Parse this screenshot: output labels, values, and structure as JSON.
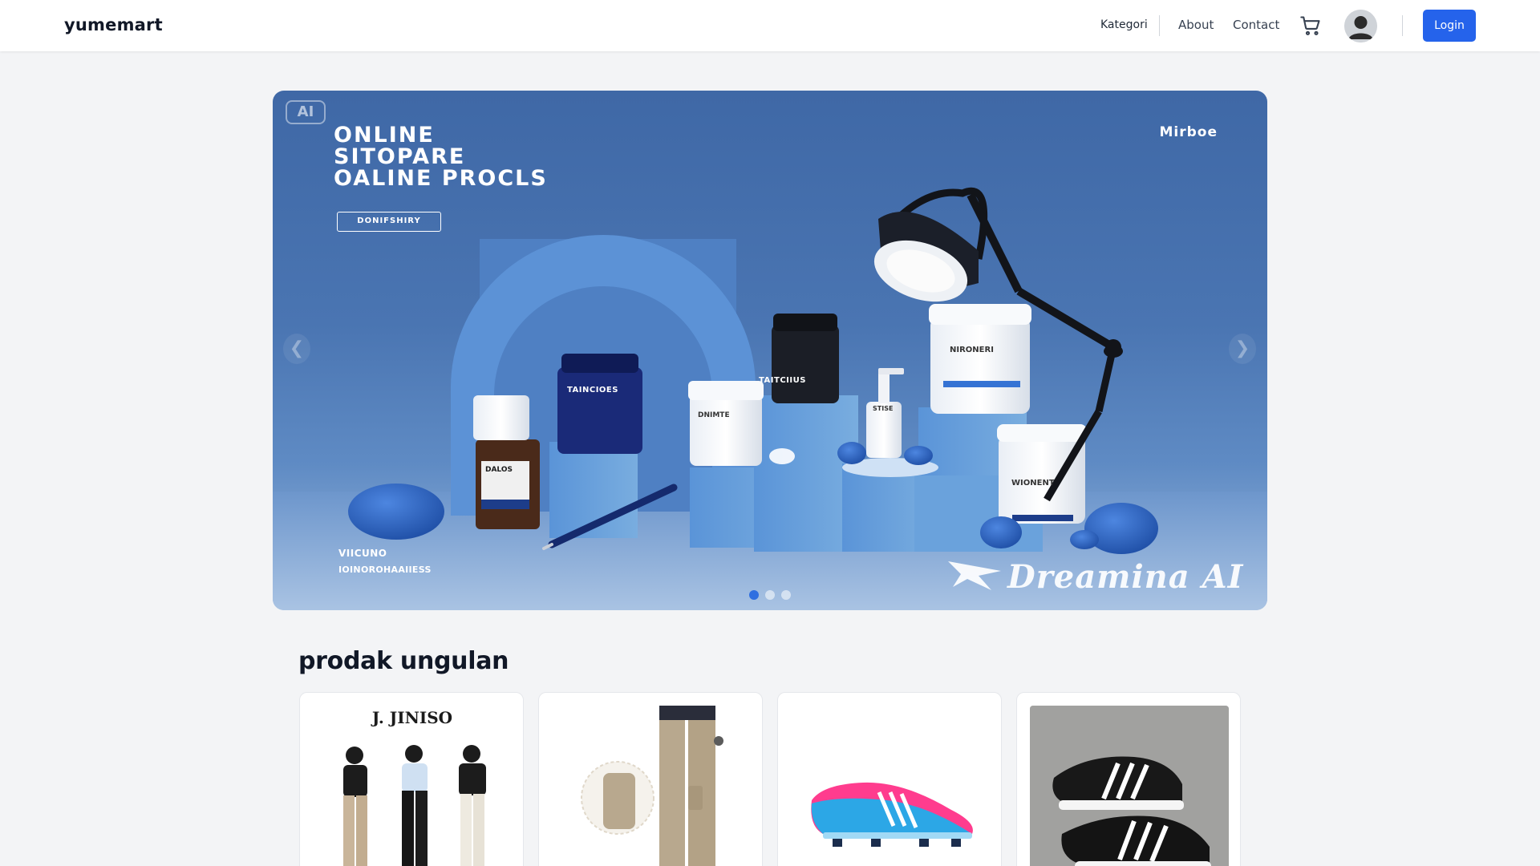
{
  "navbar": {
    "brand": "yumemart",
    "links": {
      "kategori": "Kategori",
      "about": "About",
      "contact": "Contact"
    },
    "login_label": "Login"
  },
  "hero": {
    "badge": "AI",
    "headline": [
      "ONLINE",
      "SITOPARE",
      "OALINE PROCLS"
    ],
    "tag": "DONIFSHIRY",
    "brand_right": "Mirboe",
    "product_labels": [
      "TAITCIIUS",
      "TAINCIOES",
      "DALOS",
      "DNIMTE",
      "STISE",
      "NIRONERI",
      "WIONENT"
    ],
    "footer_line1": "VIICUNO",
    "footer_line2": "IOINOROHAAIIESS",
    "watermark": "Dreamina AI",
    "arrow_prev": "❮",
    "arrow_next": "❯",
    "slides_total": 3,
    "active_slide": 1,
    "colors": {
      "background_top": "#3f68a6",
      "background_bottom": "#9cb9dd",
      "active_dot": "#2f6fe0"
    }
  },
  "featured": {
    "title": "prodak ungulan",
    "products": [
      {
        "image": "three models wearing cargo pants",
        "logo": "J. JINISO"
      },
      {
        "image": "khaki cargo pants"
      },
      {
        "image": "pink and blue football boots"
      },
      {
        "image": "black adidas running shoes"
      }
    ]
  },
  "icons": [
    "cart-icon",
    "user-avatar-icon",
    "chevron-left-icon",
    "chevron-right-icon",
    "dreamina-logo-icon"
  ],
  "accent_color": "#2563eb"
}
